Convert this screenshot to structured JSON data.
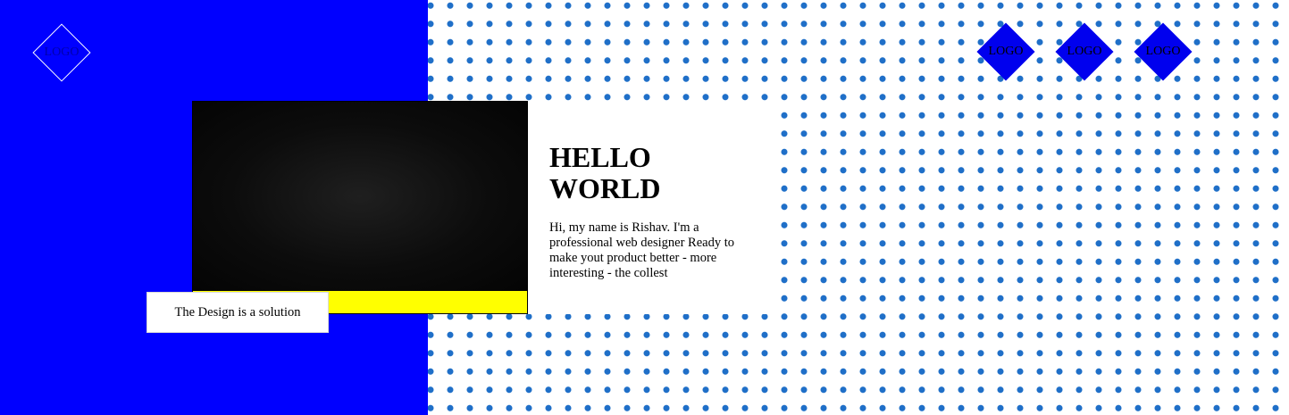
{
  "brand": {
    "main_logo_text": "LOGO"
  },
  "partner_logos": [
    {
      "text": "LOGO"
    },
    {
      "text": "LOGO"
    },
    {
      "text": "LOGO"
    }
  ],
  "hero": {
    "title_line1": "HELLO",
    "title_line2": "WORLD",
    "intro": "Hi, my name is Rishav. I'm a professional web designer Ready to make yout product better - more interesting - the collest"
  },
  "caption": {
    "text": "The Design is a solution"
  },
  "colors": {
    "left_background": "#0000ff",
    "dots": "#1f6fc8",
    "video_bar": "#ffff00",
    "logo_fill": "#0000ee"
  }
}
